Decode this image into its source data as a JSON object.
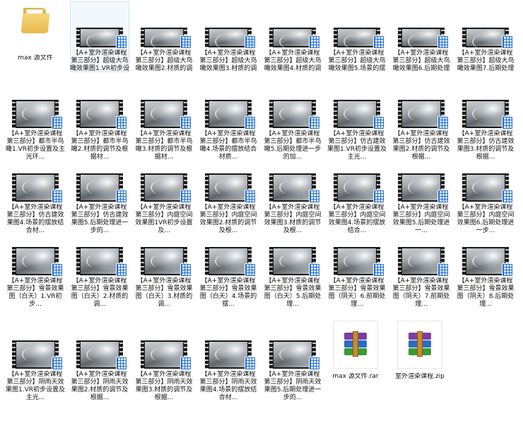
{
  "folder": {
    "label": "max 源文件",
    "icon": "folder-icon"
  },
  "videos": [
    "【A+室外渲染课程第三部分】超级大鸟瞰效果图1.VR初步设置...",
    "【A+室外渲染课程第三部分】超级大鸟瞰效果图2.材质的调节及...",
    "【A+室外渲染课程第三部分】超级大鸟瞰效果图3.材质的调节及...",
    "【A+室外渲染课程第三部分】超级大鸟瞰效果图4.材质的调节及...",
    "【A+室外渲染课程第三部分】超级大鸟瞰效果图5.场景的摆放结...",
    "【A+室外渲染课程第三部分】超级大鸟瞰效果图6.后期处理进一...",
    "【A+室外渲染课程第三部分】超级大鸟瞰效果图7.后期处理进一...",
    "【A+室外渲染课程第三部分】都市半鸟瞰1.VR初步设置及主光环...",
    "【A+室外渲染课程第三部分】都市半鸟瞰2.材质的调节及根据材...",
    "【A+室外渲染课程第三部分】都市半鸟瞰3.材质的调节及根据材...",
    "【A+室外渲染课程第三部分】都市半鸟瞰4.场景的摆放结合材质...",
    "【A+室外渲染课程第三部分】都市半鸟瞰5.后期处理进一步的加...",
    "【A+室外渲染课程第三部分】仿古建效果图1.VR初步设置及主光...",
    "【A+室外渲染课程第三部分】仿古建效果图2.材质的调节及根据...",
    "【A+室外渲染课程第三部分】仿古建效果图3.材质的调节及根据...",
    "【A+室外渲染课程第三部分】仿古建效果图4.场景的摆放结合材...",
    "【A+室外渲染课程第三部分】仿古建效果图5.后期处理进一步的...",
    "【A+室外渲染课程第三部分】内庭空间效果图1VR初步设置及...",
    "【A+室外渲染课程第三部分】内庭空间效果图2.材质的调节及根...",
    "【A+室外渲染课程第三部分】内庭空间效果图3.材质的调节及根...",
    "【A+室外渲染课程第三部分】内庭空间效果图4.场景的摆放结合...",
    "【A+室外渲染课程第三部分】内庭空间效果图5.后期处理进一...",
    "【A+室外渲染课程第三部分】内庭空间效果图6.后期处理进一步...",
    "【A+室外渲染课程第三部分】雪景效果图（白天）1.VR初步...",
    "【A+室外渲染课程第三部分】雪景效果图（白天）2.材质的调...",
    "【A+室外渲染课程第三部分】雪景效果图（白天）3.材质的调...",
    "【A+室外渲染课程第三部分】雪景效果图（白天）4.场景的摆...",
    "【A+室外渲染课程第三部分】雪景效果图（白天）5.后期处理...",
    "【A+室外渲染课程第三部分】雪景效果图（阴天）6.前期处理...",
    "【A+室外渲染课程第三部分】雪景效果图（阴天）7.前期处理...",
    "【A+室外渲染课程第三部分】雪景效果图（阴天）8.后期处理...",
    "【A+室外渲染课程第三部分】阴雨天效果图1.VR初步设置及主光...",
    "【A+室外渲染课程第三部分】阴雨天效果图2.材质的调节及根据...",
    "【A+室外渲染课程第三部分】阴雨天效果图3.材质的调节及根据...",
    "【A+室外渲染课程第三部分】阴雨天效果图4.场景的摆放结合材...",
    "【A+室外渲染课程第三部分】阴雨天效果图5.后期处理进一步的..."
  ],
  "archives": [
    {
      "label": "max 源文件.rar",
      "icon": "winrar-archive-icon"
    },
    {
      "label": "室外渲染课程.zip",
      "icon": "winrar-archive-icon"
    }
  ]
}
